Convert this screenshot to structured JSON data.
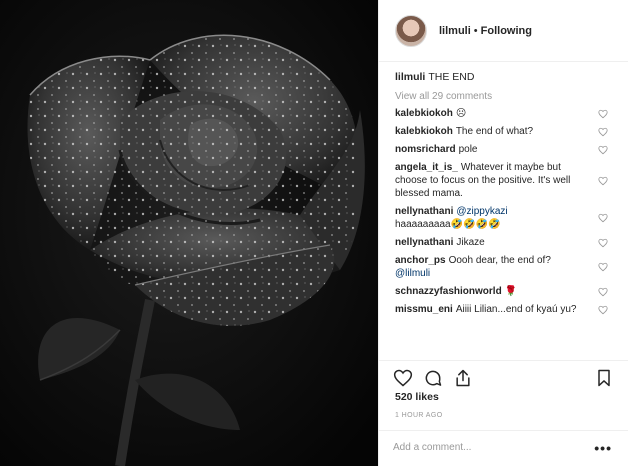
{
  "header": {
    "username": "lilmuli",
    "separator": "•",
    "follow_status": "Following"
  },
  "caption": {
    "user": "lilmuli",
    "text": "THE END"
  },
  "view_all": "View all 29 comments",
  "comments": [
    {
      "user": "kalebkiokoh",
      "text": "☹"
    },
    {
      "user": "kalebkiokoh",
      "text": "The end of what?"
    },
    {
      "user": "nomsrichard",
      "text": "pole"
    },
    {
      "user": "angela_it_is_",
      "text": "Whatever it maybe but choose to focus on the positive. It's well blessed mama."
    },
    {
      "user": "nellynathani",
      "mention": "@zippykazi",
      "text": "haaaaaaaaa🤣🤣🤣🤣"
    },
    {
      "user": "nellynathani",
      "text": "Jikaze"
    },
    {
      "user": "anchor_ps",
      "text": "Oooh dear, the end of?",
      "mention_after": "@lilmuli"
    },
    {
      "user": "schnazzyfashionworld",
      "text": "🌹"
    },
    {
      "user": "missmu_eni",
      "text": "Aiiii Lilian...end of kyaú yu?"
    }
  ],
  "likes": "520 likes",
  "time": "1 HOUR AGO",
  "add_comment_placeholder": "Add a comment...",
  "more_label": "•••",
  "icons": {
    "like": "heart-icon",
    "comment": "comment-icon",
    "share": "share-icon",
    "save": "bookmark-icon"
  }
}
